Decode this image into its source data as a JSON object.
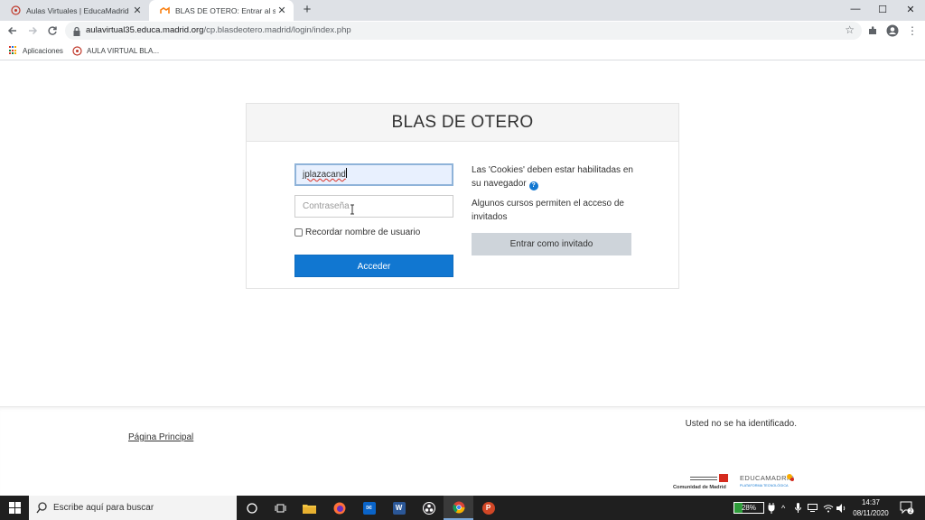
{
  "browser": {
    "tabs": [
      {
        "title": "Aulas Virtuales | EducaMadrid",
        "active": false,
        "favicon": "educamadrid-favicon"
      },
      {
        "title": "BLAS DE OTERO: Entrar al sitio",
        "active": true,
        "favicon": "moodle-favicon"
      }
    ],
    "url": {
      "host": "aulavirtual35.educa.madrid.org",
      "path": "/cp.blasdeotero.madrid/login/index.php"
    },
    "bookmarks": [
      {
        "label": "Aplicaciones",
        "icon": "apps-grid-icon"
      },
      {
        "label": "AULA VIRTUAL BLA...",
        "icon": "educamadrid-favicon"
      }
    ]
  },
  "page": {
    "site_name": "BLAS DE OTERO",
    "login": {
      "username_value": "jplazacand",
      "password_placeholder": "Contraseña",
      "remember_label": "Recordar nombre de usuario",
      "submit_label": "Acceder"
    },
    "info": {
      "cookies_text": "Las 'Cookies' deben estar habilitadas en su navegador",
      "guest_text": "Algunos cursos permiten el acceso de invitados",
      "guest_button": "Entrar como invitado"
    },
    "footer": {
      "not_logged": "Usted no se ha identificado.",
      "home_link": "Página Principal",
      "logo_cm_text": "Comunidad de Madrid",
      "logo_em_text": "EDUCAMADRID",
      "logo_em_sub": "PLATAFORMA TECNOLÓGICA"
    }
  },
  "taskbar": {
    "search_placeholder": "Escribe aquí para buscar",
    "battery": "28%",
    "time": "14:37",
    "date": "08/11/2020",
    "notifications": "2"
  },
  "colors": {
    "accent": "#1177d1",
    "guest_button": "#ced4da",
    "header_bg": "#f5f5f5"
  }
}
